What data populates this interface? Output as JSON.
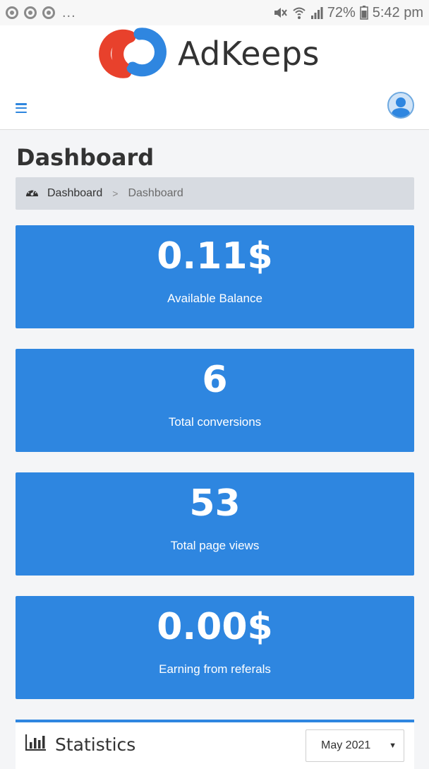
{
  "status_bar": {
    "notification_dots": "...",
    "battery_percent": "72%",
    "time": "5:42 pm"
  },
  "app": {
    "name": "AdKeeps",
    "logo_colors": {
      "red": "#e8412c",
      "blue": "#2f86e0"
    }
  },
  "nav": {
    "menu_icon": "hamburger-icon",
    "avatar_icon": "user-avatar-icon"
  },
  "page": {
    "title": "Dashboard"
  },
  "breadcrumb": {
    "home_icon": "dashboard-gauge-icon",
    "home_label": "Dashboard",
    "separator": ">",
    "current": "Dashboard"
  },
  "cards": [
    {
      "value": "0.11$",
      "label": "Available Balance"
    },
    {
      "value": "6",
      "label": "Total conversions"
    },
    {
      "value": "53",
      "label": "Total page views"
    },
    {
      "value": "0.00$",
      "label": "Earning from referals"
    }
  ],
  "statistics": {
    "icon": "bar-chart-icon",
    "title": "Statistics",
    "selected_month": "May 2021"
  },
  "colors": {
    "accent": "#2e86e0",
    "breadcrumb_bg": "#d7dbe1",
    "page_bg": "#f4f5f7"
  }
}
